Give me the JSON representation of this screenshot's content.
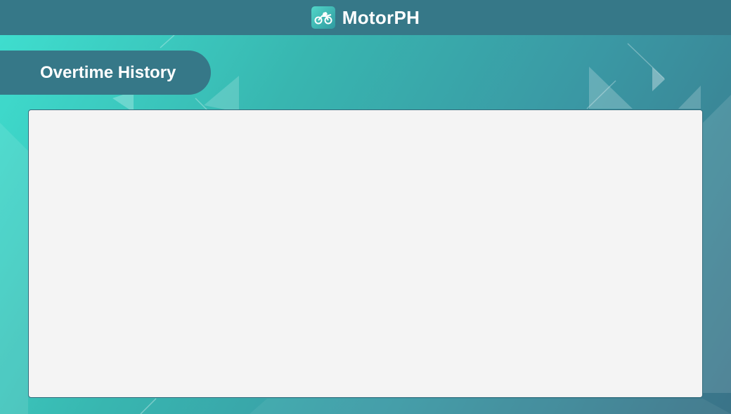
{
  "app": {
    "name": "MotorPH",
    "logo_icon": "motorcycle-rider-icon"
  },
  "page": {
    "section_title": "Overtime History"
  },
  "theme": {
    "header_color": "#367888",
    "panel_background": "#f4f4f4",
    "gradient_light": "#3fe0d0",
    "gradient_dark": "#3a7388"
  }
}
